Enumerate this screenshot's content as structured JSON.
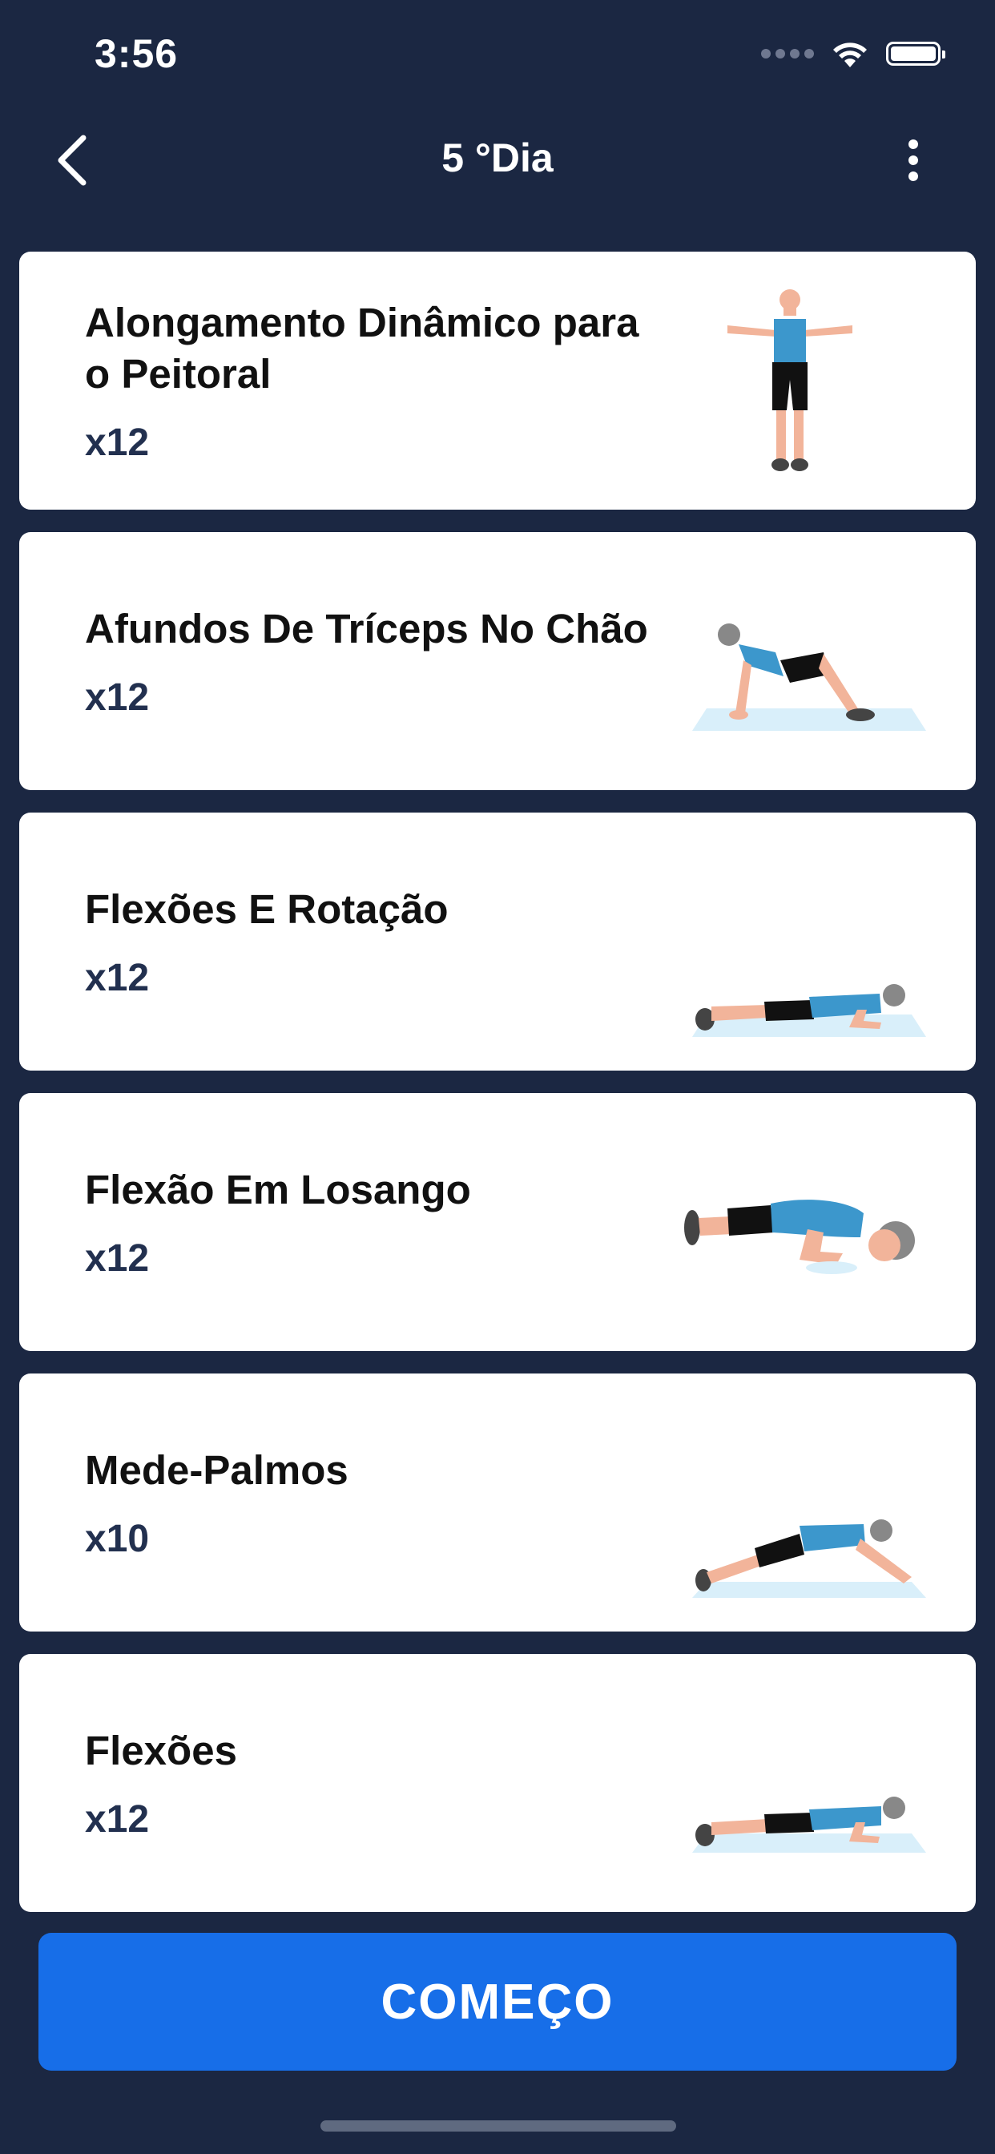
{
  "status_bar": {
    "time": "3:56"
  },
  "nav": {
    "title": "5 °Dia"
  },
  "exercises": [
    {
      "name": "Alongamento Dinâmico para o Peitoral",
      "reps": "x12",
      "figure": "standing-arms-out"
    },
    {
      "name": "Afundos De Tríceps No Chão",
      "reps": "x12",
      "figure": "triceps-dip"
    },
    {
      "name": "Flexões E Rotação",
      "reps": "x12",
      "figure": "pushup-low"
    },
    {
      "name": "Flexão Em Losango",
      "reps": "x12",
      "figure": "diamond-pushup"
    },
    {
      "name": "Mede-Palmos",
      "reps": "x10",
      "figure": "inchworm"
    },
    {
      "name": "Flexões",
      "reps": "x12",
      "figure": "pushup-low"
    }
  ],
  "start_button": {
    "label": "COMEÇO"
  },
  "colors": {
    "background": "#1b2742",
    "accent": "#176ee8",
    "shirt": "#3c97cc",
    "mat": "#d9effa",
    "skin": "#f2b49a"
  }
}
